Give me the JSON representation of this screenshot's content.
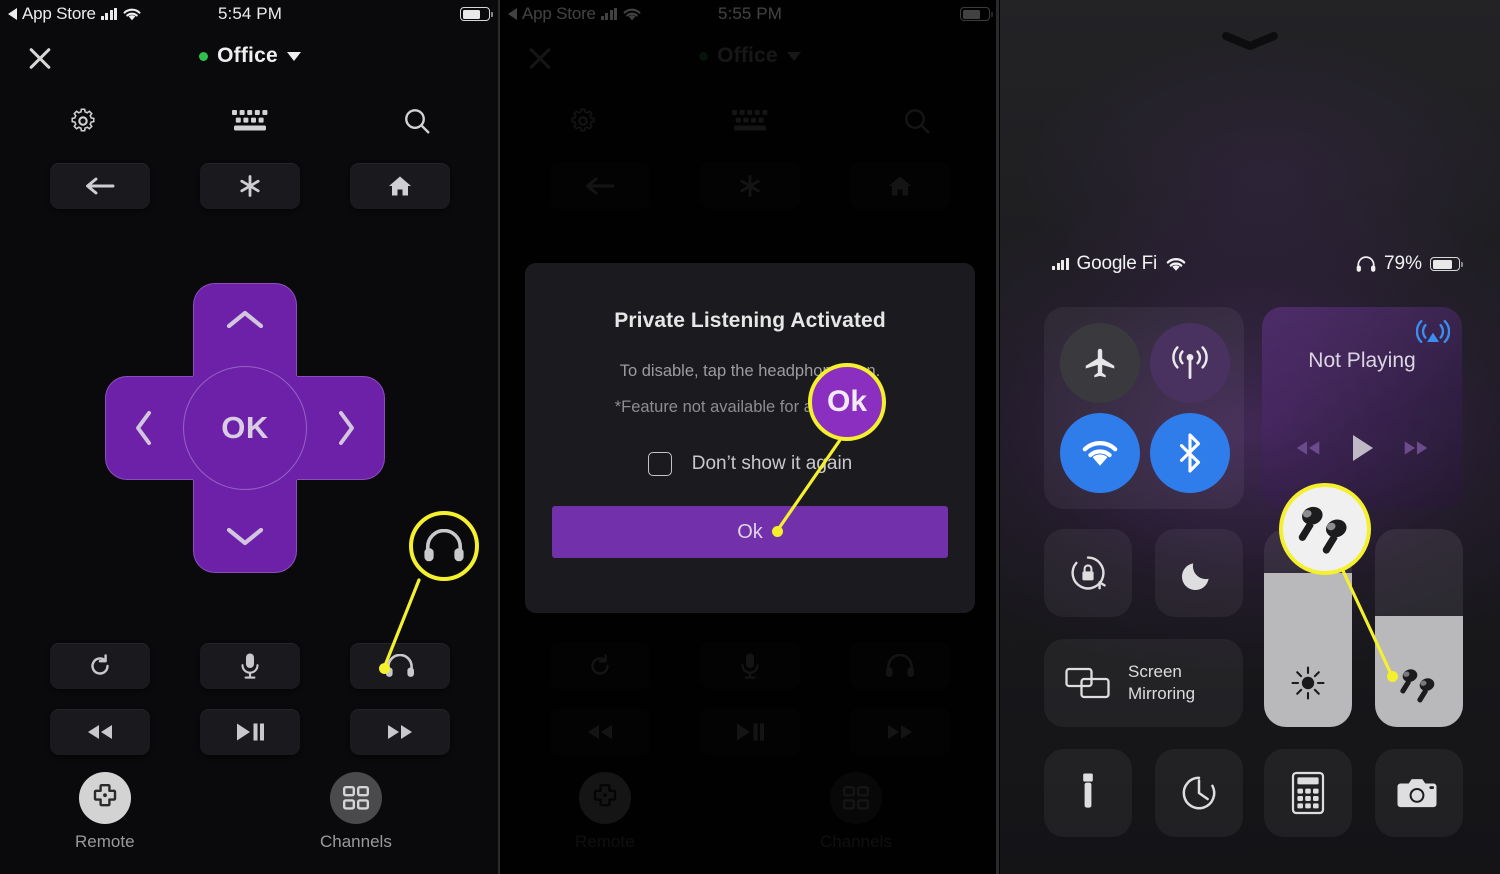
{
  "panels": {
    "left": {
      "status_bar": {
        "back_label": "App Store",
        "time": "5:54 PM"
      },
      "header": {
        "device_name": "Office",
        "close_icon": "close-icon",
        "status_dot": "connected-dot"
      },
      "icon_row": [
        {
          "name": "settings-icon",
          "label": "Settings"
        },
        {
          "name": "keyboard-icon",
          "label": "Keyboard"
        },
        {
          "name": "search-icon",
          "label": "Search"
        }
      ],
      "top_buttons": [
        {
          "name": "back-button",
          "icon": "arrow-left-icon"
        },
        {
          "name": "options-button",
          "icon": "asterisk-icon"
        },
        {
          "name": "home-button",
          "icon": "home-icon"
        }
      ],
      "dpad": {
        "ok_label": "OK",
        "up": "chevron-up-icon",
        "down": "chevron-down-icon",
        "left": "chevron-left-icon",
        "right": "chevron-right-icon"
      },
      "mid_buttons": [
        {
          "name": "replay-button",
          "icon": "replay-icon"
        },
        {
          "name": "voice-button",
          "icon": "microphone-icon"
        },
        {
          "name": "headphone-button",
          "icon": "headphone-icon"
        }
      ],
      "play_buttons": [
        {
          "name": "rewind-button",
          "icon": "rewind-icon"
        },
        {
          "name": "play-pause-button",
          "icon": "play-pause-icon"
        },
        {
          "name": "fast-forward-button",
          "icon": "fast-forward-icon"
        }
      ],
      "tabs": [
        {
          "name": "tab-remote",
          "label": "Remote",
          "icon": "dpad-icon",
          "active": true
        },
        {
          "name": "tab-channels",
          "label": "Channels",
          "icon": "grid-icon",
          "active": false
        }
      ],
      "callout": {
        "icon": "headphone-icon",
        "color": "#f5f02e"
      }
    },
    "middle": {
      "status_bar": {
        "back_label": "App Store",
        "time": "5:55 PM"
      },
      "header": {
        "device_name": "Office"
      },
      "dialog": {
        "title": "Private Listening Activated",
        "line1": "To disable, tap the headphone icon.",
        "line2": "*Feature not available for all devices.",
        "checkbox_label": "Don’t show it again",
        "ok_label": "Ok"
      },
      "callout": {
        "label": "Ok",
        "circle_color": "#8a2fc0",
        "ring_color": "#f5f02e"
      }
    },
    "right": {
      "grabber": "chevron-down-icon",
      "status_bar": {
        "signal": "cellular-bars-icon",
        "carrier": "Google Fi",
        "wifi": "wifi-icon",
        "headphone": "headphone-icon",
        "battery_percent": "79%"
      },
      "toggles": [
        {
          "name": "airplane-mode-toggle",
          "icon": "airplane-icon",
          "state": "off",
          "color": "#3a3a3e"
        },
        {
          "name": "cellular-data-toggle",
          "icon": "cellular-antenna-icon",
          "state": "on",
          "color": "#4a3260"
        },
        {
          "name": "wifi-toggle",
          "icon": "wifi-icon",
          "state": "on",
          "color": "#2f7ceb"
        },
        {
          "name": "bluetooth-toggle",
          "icon": "bluetooth-icon",
          "state": "on",
          "color": "#2f7ceb"
        }
      ],
      "media": {
        "title": "Not Playing",
        "airplay_icon": "airplay-icon",
        "controls": [
          {
            "name": "media-rewind-button",
            "icon": "rewind-icon"
          },
          {
            "name": "media-play-button",
            "icon": "play-icon"
          },
          {
            "name": "media-forward-button",
            "icon": "fast-forward-icon"
          }
        ]
      },
      "tiles": [
        {
          "name": "rotation-lock-tile",
          "icon": "rotation-lock-icon"
        },
        {
          "name": "do-not-disturb-tile",
          "icon": "moon-icon"
        }
      ],
      "screen_mirroring": {
        "label_line1": "Screen",
        "label_line2": "Mirroring",
        "icon": "screen-mirroring-icon"
      },
      "sliders": [
        {
          "name": "brightness-slider",
          "icon": "brightness-icon",
          "value": 78
        },
        {
          "name": "volume-slider",
          "icon": "earbuds-icon",
          "value": 56
        }
      ],
      "bottom_tiles": [
        {
          "name": "flashlight-tile",
          "icon": "flashlight-icon"
        },
        {
          "name": "timer-tile",
          "icon": "timer-icon"
        },
        {
          "name": "calculator-tile",
          "icon": "calculator-icon"
        },
        {
          "name": "camera-tile",
          "icon": "camera-icon"
        }
      ],
      "callout": {
        "icon": "earbuds-icon",
        "ring_color": "#f5f02e"
      }
    }
  }
}
